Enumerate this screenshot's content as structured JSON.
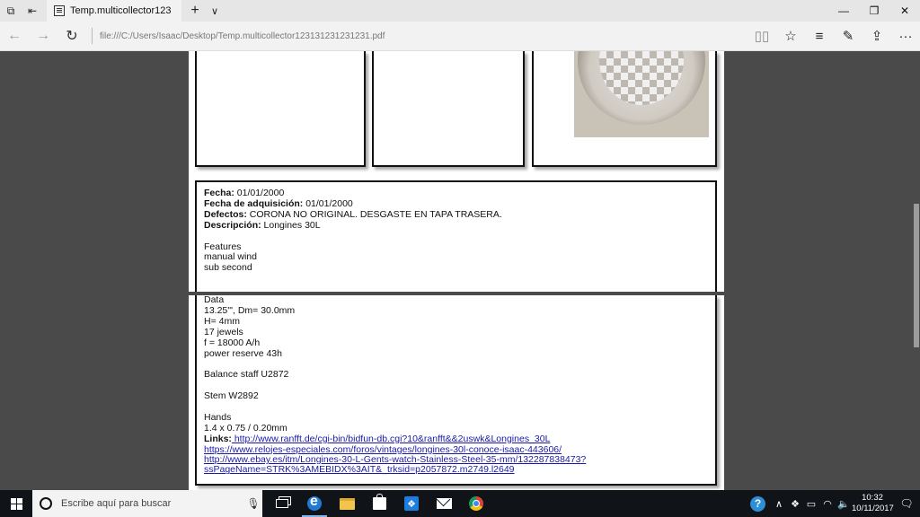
{
  "browser": {
    "tab_title": "Temp.multicollector123",
    "url": "file:///C:/Users/Isaac/Desktop/Temp.multicollector123131231231231.pdf"
  },
  "document": {
    "fecha_label": "Fecha:",
    "fecha_value": " 01/01/2000",
    "adquisicion_label": "Fecha de adquisición:",
    "adquisicion_value": " 01/01/2000",
    "defectos_label": "Defectos:",
    "defectos_value": " CORONA NO ORIGINAL. DESGASTE EN TAPA TRASERA.",
    "descripcion_label": "Descripción:",
    "descripcion_value": " Longines 30L",
    "features": [
      "Features",
      "manual wind",
      "sub second"
    ],
    "data_lines": [
      "Data",
      "13.25'\", Dm= 30.0mm",
      "H= 4mm",
      "17 jewels",
      "f = 18000 A/h",
      "power reserve 43h"
    ],
    "balance": "Balance staff U2872",
    "stem": "Stem W2892",
    "hands": [
      "Hands",
      "1.4 x 0.75 / 0.20mm"
    ],
    "links_label": "Links:",
    "links": [
      " http://www.ranfft.de/cgi-bin/bidfun-db.cgi?10&ranfft&&2uswk&Longines_30L",
      "https://www.relojes-especiales.com/foros/vintages/longines-30l-conoce-isaac-443606/",
      "http://www.ebay.es/itm/Longines-30-L-Gents-watch-Stainless-Steel-35-mm/132287838473?",
      "ssPageName=STRK%3AMEBIDX%3AIT&_trksid=p2057872.m2749.l2649"
    ]
  },
  "taskbar": {
    "search_placeholder": "Escribe aquí para buscar",
    "time": "10:32",
    "date": "10/11/2017"
  }
}
